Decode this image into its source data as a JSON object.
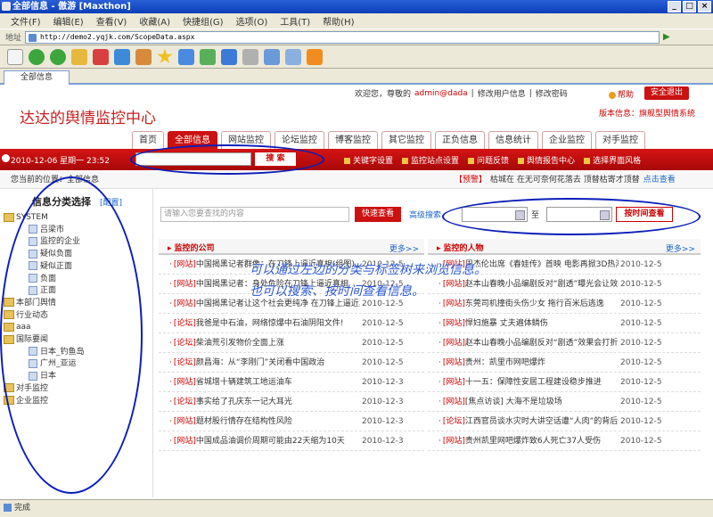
{
  "window": {
    "title": "全部信息 - 傲游 [Maxthon]"
  },
  "menu": [
    "文件(F)",
    "编辑(E)",
    "查看(V)",
    "收藏(A)",
    "快捷组(G)",
    "选项(O)",
    "工具(T)",
    "帮助(H)"
  ],
  "address": {
    "label": "地址",
    "url": "http://demo2.yqjk.com/ScopeData.aspx"
  },
  "tab": {
    "label": "全部信息"
  },
  "header": {
    "site_title": "达达的舆情监控中心",
    "welcome": "欢迎您，尊敬的",
    "user": "admin@dada",
    "edit_profile": "修改用户信息",
    "separator": "|",
    "change_password": "修改密码",
    "help": "帮助",
    "logout": "安全退出",
    "version": "版本信息：旗舰型舆情系统"
  },
  "nav_tabs": [
    {
      "label": "首页",
      "active": false
    },
    {
      "label": "全部信息",
      "active": true
    },
    {
      "label": "网站监控",
      "active": false
    },
    {
      "label": "论坛监控",
      "active": false
    },
    {
      "label": "博客监控",
      "active": false
    },
    {
      "label": "其它监控",
      "active": false
    },
    {
      "label": "正负信息",
      "active": false
    },
    {
      "label": "信息统计",
      "active": false
    },
    {
      "label": "企业监控",
      "active": false
    },
    {
      "label": "对手监控",
      "active": false
    }
  ],
  "redbar": {
    "date": "2010-12-06 星期一  23:52",
    "search_button": "搜 索",
    "links": [
      "关键字设置",
      "监控站点设置",
      "问题反馈",
      "舆情报告中心",
      "选择界面风格"
    ]
  },
  "breadcrumb": {
    "text": "您当前的位置：全部信息"
  },
  "warning": {
    "tag": "【预警】",
    "text": "枯城在 在无可奈何花落去 顶替枯寄才顶替",
    "link": "点击查看"
  },
  "sidebar": {
    "title": "信息分类选择",
    "config": "[配置]",
    "tree": [
      {
        "label": "SYSTEM",
        "level": 0,
        "type": "folder"
      },
      {
        "label": "吕梁市",
        "level": 2,
        "type": "leaf"
      },
      {
        "label": "监控的企业",
        "level": 2,
        "type": "leaf"
      },
      {
        "label": "疑似负面",
        "level": 2,
        "type": "leaf"
      },
      {
        "label": "疑似正面",
        "level": 2,
        "type": "leaf"
      },
      {
        "label": "负面",
        "level": 2,
        "type": "leaf"
      },
      {
        "label": "正面",
        "level": 2,
        "type": "leaf"
      },
      {
        "label": "本部门舆情",
        "level": 0,
        "type": "folder"
      },
      {
        "label": "行业动态",
        "level": 0,
        "type": "folder"
      },
      {
        "label": "aaa",
        "level": 0,
        "type": "folder"
      },
      {
        "label": "国际要闻",
        "level": 0,
        "type": "folder"
      },
      {
        "label": "日本_钓鱼岛",
        "level": 2,
        "type": "leaf"
      },
      {
        "label": "广州_亚运",
        "level": 2,
        "type": "leaf"
      },
      {
        "label": "日本",
        "level": 2,
        "type": "leaf"
      },
      {
        "label": "对手监控",
        "level": 0,
        "type": "folder"
      },
      {
        "label": "企业监控",
        "level": 0,
        "type": "folder"
      }
    ]
  },
  "search": {
    "placeholder": "请输入您要查找的内容",
    "quick_button": "快速查看",
    "advanced": "高级搜索",
    "to": "至",
    "time_button": "按时间查看"
  },
  "panels": [
    {
      "title": "监控的公司",
      "more": "更多>>",
      "rows": [
        {
          "badge": "[网站]",
          "title": "中国揭黑记者群像：在刀锋上逼近真相(组图)",
          "date": "2010-12-5"
        },
        {
          "badge": "[网站]",
          "title": "中国揭黑记者：身处危险在刀锋上逼近真相",
          "date": "2010-12-5"
        },
        {
          "badge": "[网站]",
          "title": "中国揭黑记者让这个社会更纯净 在刀锋上逼近真相",
          "date": "2010-12-5"
        },
        {
          "badge": "[论坛]",
          "title": "我爸是中石油，网络惊爆中石油阴阳文件!",
          "date": "2010-12-5"
        },
        {
          "badge": "[论坛]",
          "title": "柴油荒引发物价全面上涨",
          "date": "2010-12-5"
        },
        {
          "badge": "[论坛]",
          "title": "颜昌海：从“李刚门”关闭看中国政治",
          "date": "2010-12-5"
        },
        {
          "badge": "[网站]",
          "title": "省城增十辆建筑工地运油车",
          "date": "2010-12-3"
        },
        {
          "badge": "[论坛]",
          "title": "事实给了孔庆东一记大耳光",
          "date": "2010-12-3"
        },
        {
          "badge": "[网站]",
          "title": "题材股行情存在结构性风险",
          "date": "2010-12-3"
        },
        {
          "badge": "[网站]",
          "title": "中国成品油调价周期可能由22天缩为10天",
          "date": "2010-12-3"
        }
      ]
    },
    {
      "title": "监控的人物",
      "more": "更多>>",
      "rows": [
        {
          "badge": "[网站]",
          "title": "周杰伦出席《春娃传》首映 电影再掀3D热潮",
          "date": "2010-12-5"
        },
        {
          "badge": "[网站]",
          "title": "赵本山春晚小品编剧反对“剧透”曝光会让效果打折",
          "date": "2010-12-5"
        },
        {
          "badge": "[网站]",
          "title": "东莞司机撞街头伤少女 拖行百米后逃逸",
          "date": "2010-12-5"
        },
        {
          "badge": "[网站]",
          "title": "悍妇施暴 丈夫遍体鳞伤",
          "date": "2010-12-5"
        },
        {
          "badge": "[网站]",
          "title": "赵本山春晚小品编剧反对“剧透”效果会打折",
          "date": "2010-12-5"
        },
        {
          "badge": "[网站]",
          "title": "贵州：凯里市网吧爆炸",
          "date": "2010-12-5"
        },
        {
          "badge": "[网站]",
          "title": "十一五：保障性安居工程建设稳步推进",
          "date": "2010-12-5"
        },
        {
          "badge": "[网站]",
          "title": "[焦点访谈] 大海不是垃圾场",
          "date": "2010-12-5"
        },
        {
          "badge": "[论坛]",
          "title": "江西官员谈水灾时大讲空话遭“人肉”的背后",
          "date": "2010-12-5"
        },
        {
          "badge": "[网站]",
          "title": "贵州凯里网吧爆炸致6人死亡37人受伤",
          "date": "2010-12-5"
        }
      ]
    }
  ],
  "overlay": {
    "line1": "可以通过左边的分类与标签树来浏览信息。",
    "line2": "也可以搜索、按时间查看信息。"
  },
  "status": {
    "text": "完成"
  },
  "colors": {
    "brand_red": "#cc1111",
    "annotation_blue": "#0a1eb8",
    "link_blue": "#1a66c8"
  }
}
